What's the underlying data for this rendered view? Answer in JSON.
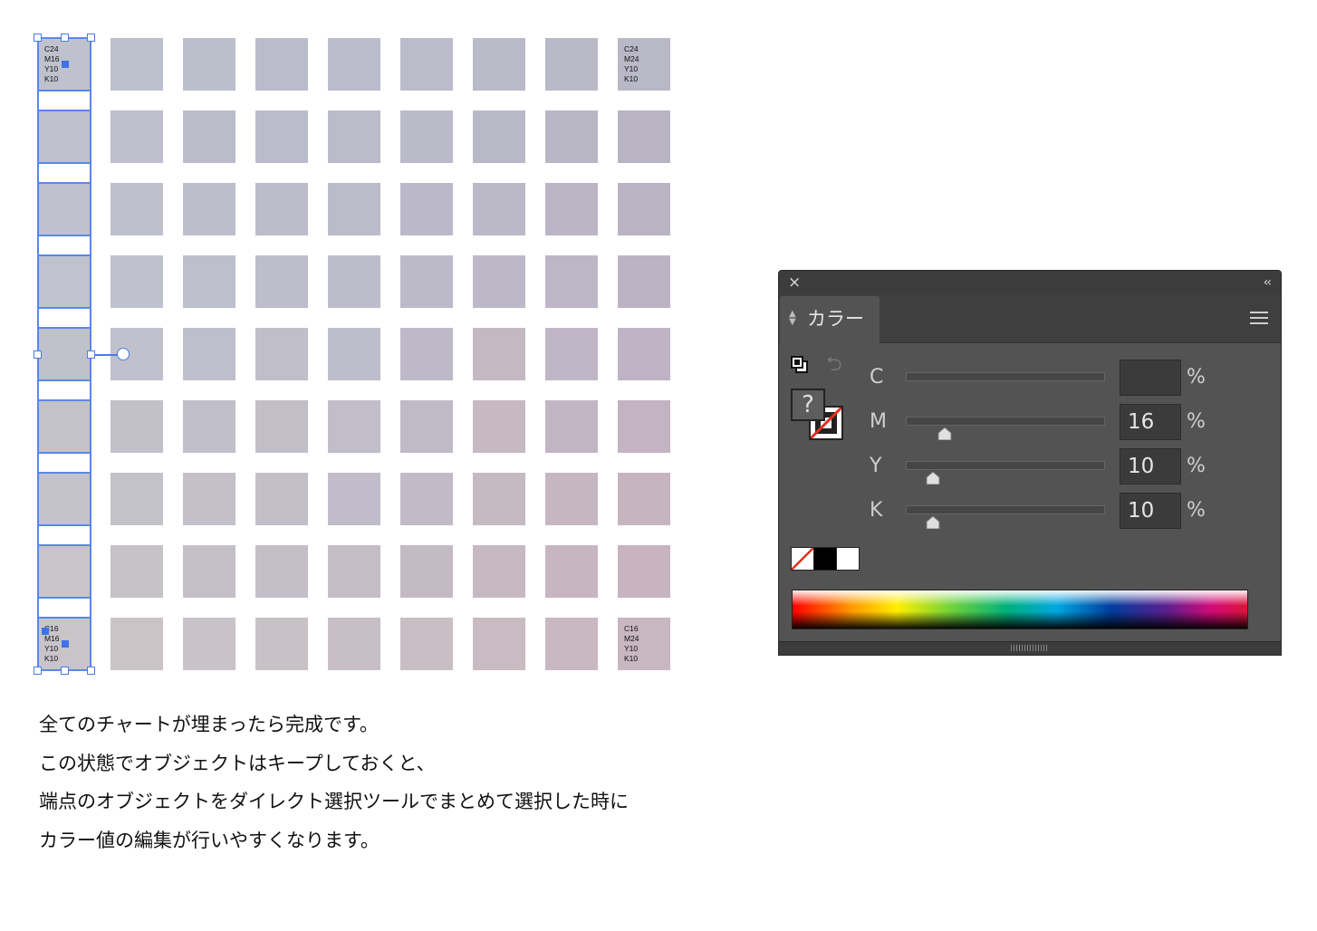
{
  "artboard": {
    "columns": 9,
    "rows": 9,
    "corner_labels": {
      "top_left": "C24\nM16\nY10\nK10",
      "top_right": "C24\nM24\nY10\nK10",
      "bottom_left": "C16\nM16\nY10\nK10",
      "bottom_right": "C16\nM24\nY10\nK10"
    },
    "swatch_colors": [
      [
        "#bfc2cd",
        "#bcc0cc",
        "#bbbecb",
        "#bbbccb",
        "#bbbccb",
        "#bbbbca",
        "#babac8",
        "#b9b9c7",
        "#b9b8c7"
      ],
      [
        "#bfc2cd",
        "#bdbfcc",
        "#bcbdcb",
        "#bbbccb",
        "#bbbbca",
        "#bbbac9",
        "#b9b8c7",
        "#b9b6c5",
        "#b8b4c4"
      ],
      [
        "#bfc1cd",
        "#bec0cc",
        "#bdbecb",
        "#bcbccb",
        "#bcbbca",
        "#bbb9c9",
        "#bbb8c7",
        "#bbb5c5",
        "#bab3c4"
      ],
      [
        "#c0c2cd",
        "#bfc1cd",
        "#bebfcc",
        "#bdbdcb",
        "#bdbccb",
        "#bcb9c9",
        "#bcb8c8",
        "#bcb6c6",
        "#bcb3c4"
      ],
      [
        "#c0c2cb",
        "#c0c1cc",
        "#bfbfcc",
        "#c0bec8",
        "#bebdcb",
        "#beb9c6",
        "#c4b8c3",
        "#c1b6c6",
        "#c0b3c5"
      ],
      [
        "#c3c2c9",
        "#c2c1ca",
        "#c1bfca",
        "#c1bec8",
        "#c1bdc9",
        "#c0bac6",
        "#c6b9c2",
        "#c3b6c4",
        "#c4b3c2"
      ],
      [
        "#c4c3c9",
        "#c3c2c9",
        "#c3c0c9",
        "#c2bfc8",
        "#c1bcc9",
        "#c2bac6",
        "#c5b9c2",
        "#c6b6c2",
        "#c6b4c0"
      ],
      [
        "#c8c4c8",
        "#c6c2c8",
        "#c5c0c7",
        "#c4bec8",
        "#c4bdc6",
        "#c4bac4",
        "#c7b9c2",
        "#c7b6c2",
        "#c8b4c0"
      ],
      [
        "#c8c5c8",
        "#cbc4c6",
        "#c9c2c7",
        "#c8c1c6",
        "#c8bec5",
        "#c9bec4",
        "#c9bbc2",
        "#c9b8c2",
        "#c8b6c0"
      ]
    ]
  },
  "caption": {
    "line1": "全てのチャートが埋まったら完成です。",
    "line2": "この状態でオブジェクトはキープしておくと、",
    "line3": "端点のオブジェクトをダイレクト選択ツールでまとめて選択した時に",
    "line4": "カラー値の編集が行いやすくなります。"
  },
  "color_panel": {
    "close_icon": "×",
    "collapse_icon": "‹‹",
    "tab_label": "カラー",
    "fill_indicator": "?",
    "sliders": [
      {
        "label": "C",
        "value": "",
        "position": null
      },
      {
        "label": "M",
        "value": "16",
        "position": 0.16
      },
      {
        "label": "Y",
        "value": "10",
        "position": 0.1
      },
      {
        "label": "K",
        "value": "10",
        "position": 0.1
      }
    ],
    "percent_sign": "%",
    "quick_swatches": [
      "none",
      "black",
      "white"
    ]
  }
}
